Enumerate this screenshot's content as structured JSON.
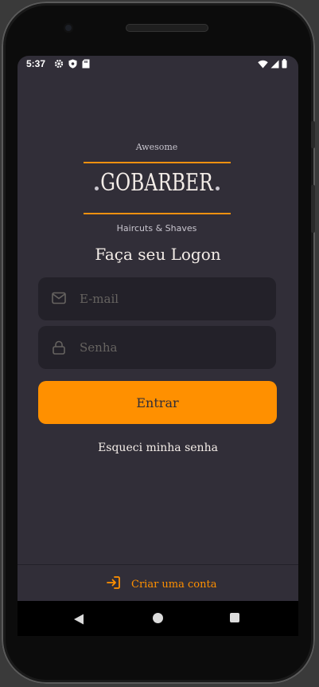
{
  "status_bar": {
    "time": "5:37",
    "left_icons": [
      "gear-icon",
      "shield-icon",
      "sd-card-icon"
    ],
    "right_icons": [
      "wifi-icon",
      "signal-icon",
      "battery-icon"
    ]
  },
  "logo": {
    "top_text": "Awesome",
    "wordmark": "GOBARBER",
    "bottom_text": "Haircuts & Shaves"
  },
  "title": "Faça seu Logon",
  "form": {
    "email_placeholder": "E-mail",
    "email_value": "",
    "password_placeholder": "Senha",
    "password_value": "",
    "submit_label": "Entrar"
  },
  "forgot_label": "Esqueci minha senha",
  "footer": {
    "create_account_label": "Criar uma conta"
  },
  "nav": {
    "buttons": [
      "back-icon",
      "home-icon",
      "recent-apps-icon"
    ]
  },
  "colors": {
    "background": "#312e38",
    "input_background": "#232129",
    "accent": "#ff9000",
    "text": "#f4ede8",
    "placeholder": "#666360"
  }
}
